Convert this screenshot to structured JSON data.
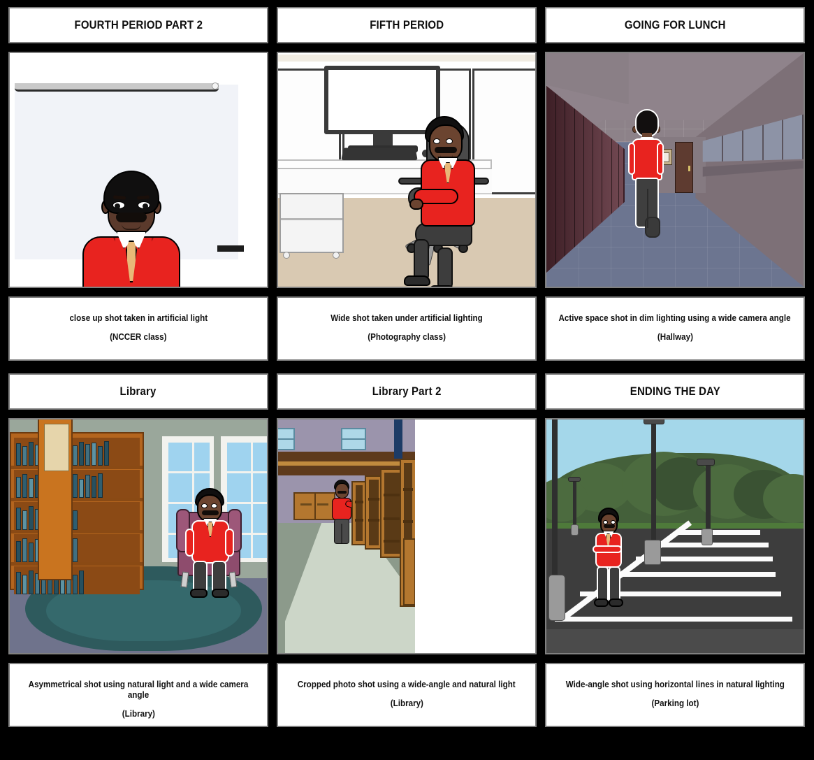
{
  "storyboard": {
    "background_color": "#000000",
    "card_background": "#ffffff",
    "card_border_color": "#808080",
    "accent_red": "#e8231f",
    "rows": 2,
    "columns": 3,
    "cells": [
      {
        "id": "cell-1",
        "title": "FOURTH PERIOD PART 2",
        "caption_line1": "close up shot taken in artificial light",
        "caption_line2": "(NCCER class)",
        "scene": "classroom-whiteboard-closeup"
      },
      {
        "id": "cell-2",
        "title": "FIFTH PERIOD",
        "caption_line1": "Wide shot taken under artificial lighting",
        "caption_line2": "(Photography class)",
        "scene": "computer-lab-desk-chair"
      },
      {
        "id": "cell-3",
        "title": "GOING FOR LUNCH",
        "caption_line1": "Active space shot in dim lighting using a wide camera angle",
        "caption_line2": "(Hallway)",
        "scene": "school-hallway-lockers"
      },
      {
        "id": "cell-4",
        "title": "Library",
        "caption_line1": "Asymmetrical shot using natural light and a wide camera angle",
        "caption_line2": "(Library)",
        "scene": "library-bookshelf-armchair"
      },
      {
        "id": "cell-5",
        "title": "Library Part 2",
        "caption_line1": "Cropped photo shot using a wide-angle and natural light",
        "caption_line2": "(Library)",
        "scene": "library-stacks-cropped"
      },
      {
        "id": "cell-6",
        "title": "ENDING THE DAY",
        "caption_line1": "Wide-angle shot using horizontal lines in natural lighting",
        "caption_line2": "(Parking lot)",
        "scene": "parking-lot-light-poles"
      }
    ]
  }
}
